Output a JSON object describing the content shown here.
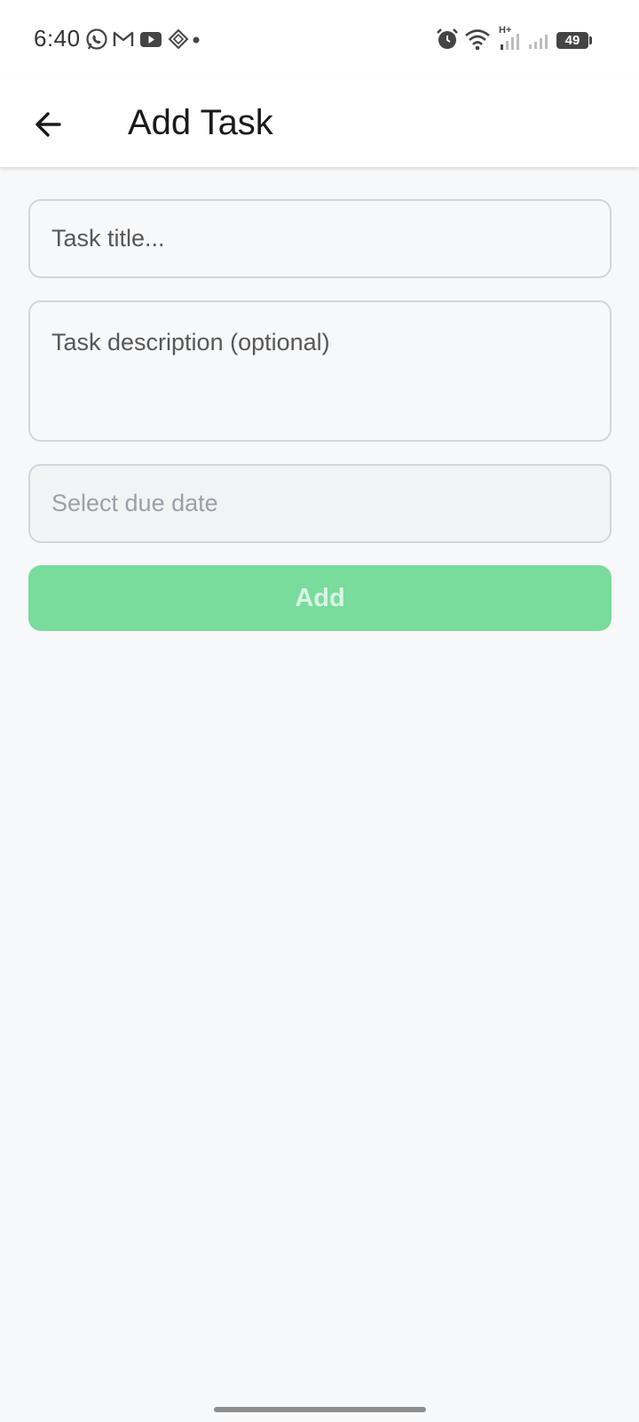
{
  "status_bar": {
    "time": "6:40",
    "battery_level": "49",
    "network_label": "H+",
    "left_icons": [
      "whatsapp-icon",
      "gmail-icon",
      "youtube-icon",
      "app-diamond-icon",
      "notification-dot-icon"
    ],
    "right_icons": [
      "alarm-icon",
      "wifi-icon",
      "signal-h-plus-icon",
      "signal-icon",
      "battery-icon"
    ]
  },
  "app_bar": {
    "title": "Add Task",
    "back_icon": "arrow-left-icon"
  },
  "form": {
    "title_placeholder": "Task title...",
    "title_value": "",
    "description_placeholder": "Task description (optional)",
    "description_value": "",
    "due_date_placeholder": "Select due date",
    "add_label": "Add"
  },
  "colors": {
    "background": "#f7f8fa",
    "app_bar": "#ffffff",
    "add_button": "#79db9c",
    "add_button_text": "#d8f5e2",
    "field_border": "#d1d5db"
  }
}
